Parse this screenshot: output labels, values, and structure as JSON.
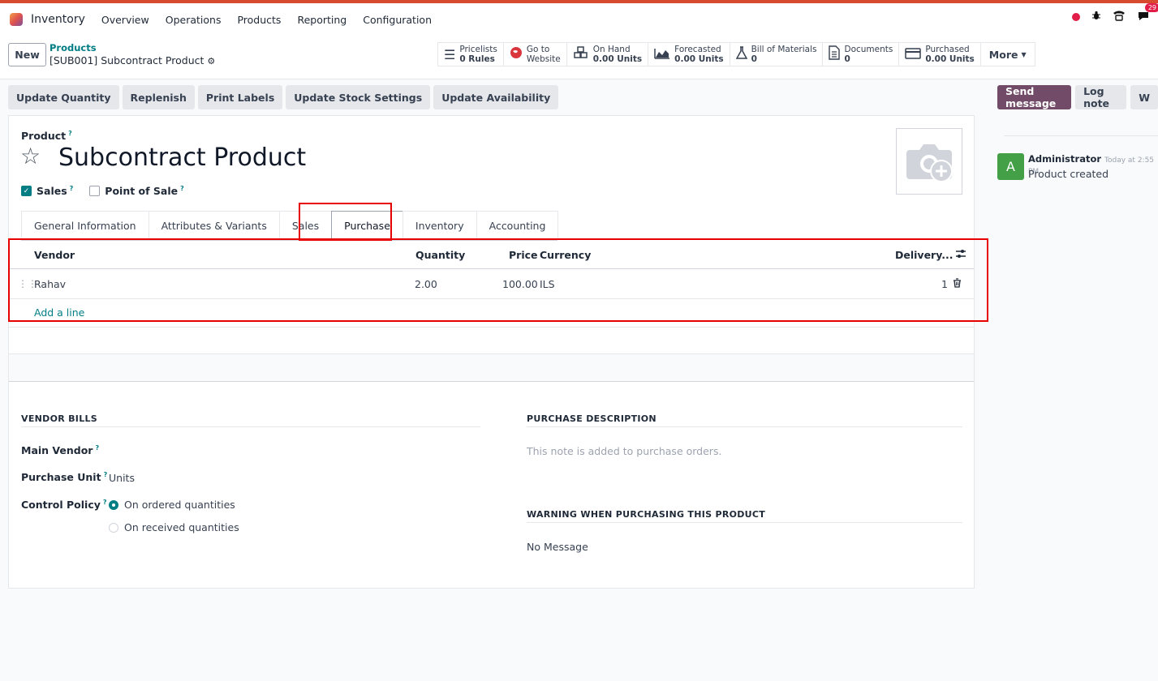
{
  "navbar": {
    "app_name": "Inventory",
    "menu": [
      "Overview",
      "Operations",
      "Products",
      "Reporting",
      "Configuration"
    ],
    "chat_badge": "29"
  },
  "control": {
    "new_label": "New",
    "breadcrumb_parent": "Products",
    "breadcrumb_current": "[SUB001] Subcontract Product",
    "smart_buttons": [
      {
        "label": "Pricelists",
        "value": "0 Rules",
        "icon": "list-icon"
      },
      {
        "label": "Go to",
        "value": "Website",
        "icon": "globe-icon"
      },
      {
        "label": "On Hand",
        "value": "0.00 Units",
        "icon": "cubes-icon"
      },
      {
        "label": "Forecasted",
        "value": "0.00 Units",
        "icon": "area-chart-icon"
      },
      {
        "label": "Bill of Materials",
        "value": "0",
        "icon": "flask-icon"
      },
      {
        "label": "Documents",
        "value": "0",
        "icon": "file-icon"
      },
      {
        "label": "Purchased",
        "value": "0.00 Units",
        "icon": "credit-card-icon"
      }
    ],
    "more_label": "More"
  },
  "actions": [
    "Update Quantity",
    "Replenish",
    "Print Labels",
    "Update Stock Settings",
    "Update Availability"
  ],
  "chatter": {
    "send_label": "Send message",
    "log_label": "Log note",
    "extra_label": "W",
    "author": "Administrator",
    "time": "Today at 2:55 PM",
    "avatar_letter": "A",
    "body": "Product created"
  },
  "form": {
    "product_label": "Product",
    "help_mark": "?",
    "title": "Subcontract Product",
    "sales_label": "Sales",
    "pos_label": "Point of Sale",
    "tabs": [
      "General Information",
      "Attributes & Variants",
      "Sales",
      "Purchase",
      "Inventory",
      "Accounting"
    ],
    "active_tab": "Purchase",
    "table": {
      "headers": {
        "vendor": "Vendor",
        "quantity": "Quantity",
        "price": "Price",
        "currency": "Currency",
        "delivery": "Delivery..."
      },
      "rows": [
        {
          "vendor": "Rahav",
          "quantity": "2.00",
          "price": "100.00",
          "currency": "ILS",
          "delivery": "1"
        }
      ],
      "add_line": "Add a line"
    },
    "vendor_bills": {
      "title": "VENDOR BILLS",
      "main_vendor_label": "Main Vendor",
      "purchase_unit_label": "Purchase Unit",
      "purchase_unit_value": "Units",
      "control_policy_label": "Control Policy",
      "policy_options": [
        "On ordered quantities",
        "On received quantities"
      ],
      "policy_selected": "On ordered quantities"
    },
    "purchase_description": {
      "title": "PURCHASE DESCRIPTION",
      "placeholder": "This note is added to purchase orders."
    },
    "warning": {
      "title": "WARNING WHEN PURCHASING THIS PRODUCT",
      "value": "No Message"
    }
  },
  "colors": {
    "accent": "#017e84",
    "brand": "#714b67",
    "highlight": "#e60000",
    "top_stripe": "#d84a2d"
  }
}
